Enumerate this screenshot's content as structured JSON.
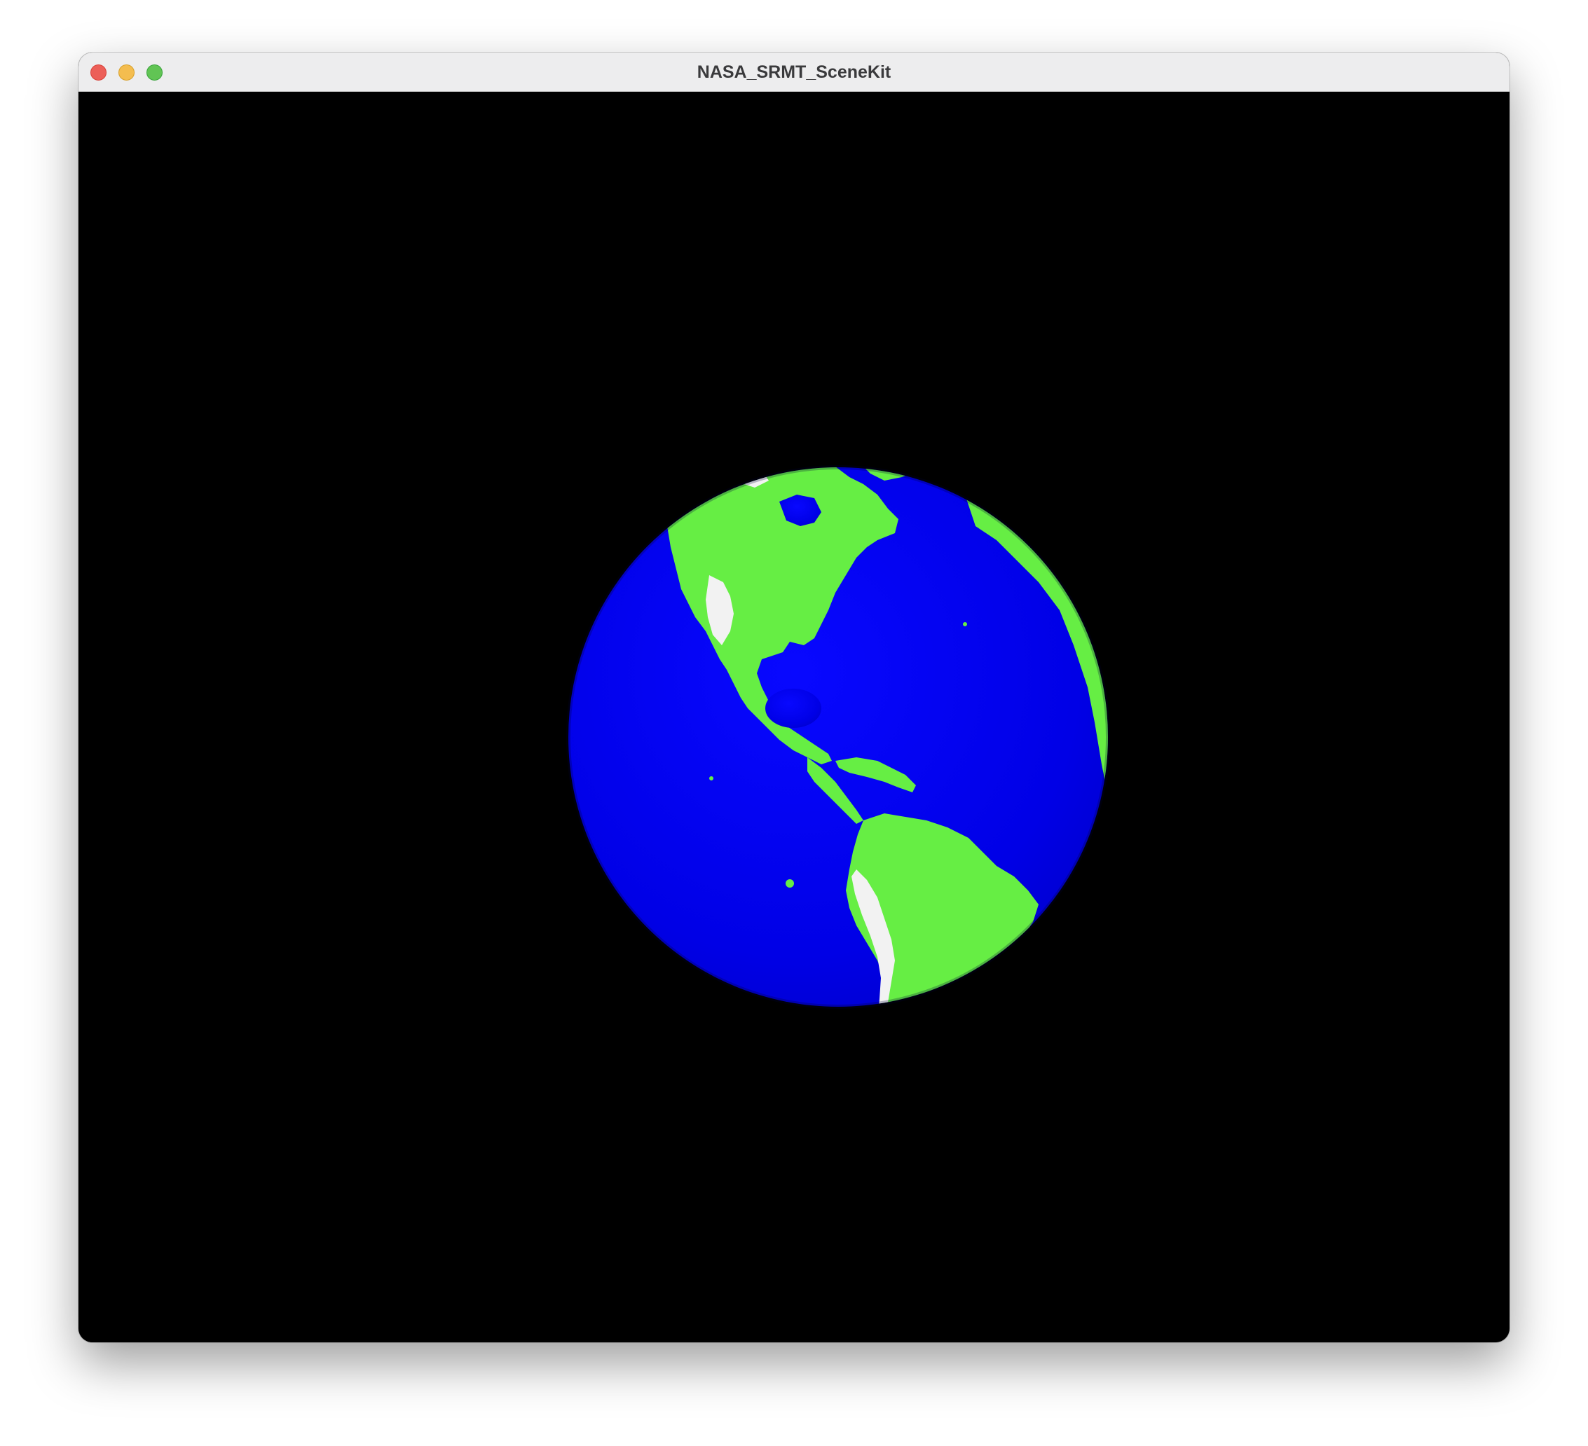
{
  "window": {
    "title": "NASA_SRMT_SceneKit",
    "controls": {
      "close_color": "#ec5f58",
      "minimize_color": "#f4bd4f",
      "zoom_color": "#61c454"
    }
  },
  "scene": {
    "background_color": "#000000",
    "globe": {
      "ocean_color": "#0000ee",
      "land_color": "#66ee44",
      "snow_color": "#f2f2f2",
      "view": "Western Hemisphere — North and South America facing viewer"
    }
  }
}
